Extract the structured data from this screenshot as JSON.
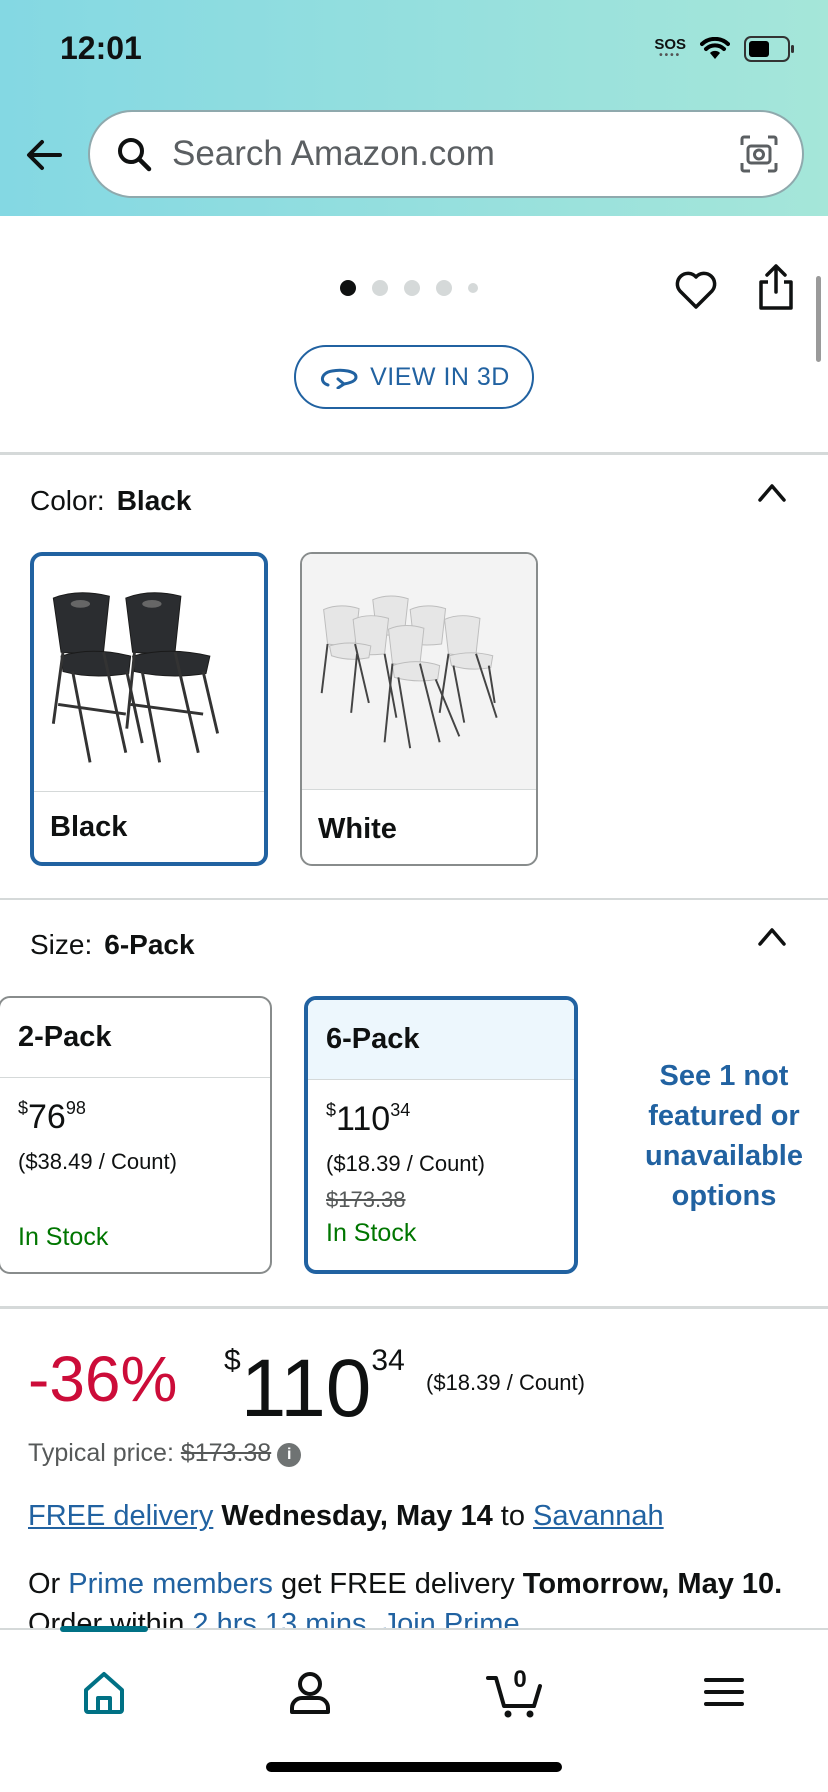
{
  "status_bar": {
    "time": "12:01",
    "sos": "SOS"
  },
  "search": {
    "placeholder": "Search Amazon.com"
  },
  "gallery": {
    "view_3d_label": "VIEW IN 3D"
  },
  "color": {
    "label": "Color:",
    "selected": "Black",
    "options": [
      {
        "name": "Black"
      },
      {
        "name": "White"
      }
    ]
  },
  "size": {
    "label": "Size:",
    "selected": "6-Pack",
    "options": [
      {
        "name": "2-Pack",
        "price_symbol": "$",
        "price_whole": "76",
        "price_fraction": "98",
        "per_unit": "($38.49 / Count)",
        "list_price": "",
        "stock": "In Stock"
      },
      {
        "name": "6-Pack",
        "price_symbol": "$",
        "price_whole": "110",
        "price_fraction": "34",
        "per_unit": "($18.39 / Count)",
        "list_price": "$173.38",
        "stock": "In Stock"
      }
    ],
    "not_featured": "See 1 not featured or unavailable options"
  },
  "price_block": {
    "discount": "-36%",
    "symbol": "$",
    "whole": "110",
    "fraction": "34",
    "per_unit": "($18.39 / Count)",
    "typical_label": "Typical price:",
    "typical_value": "$173.38"
  },
  "delivery": {
    "free_delivery": "FREE delivery",
    "date": "Wednesday, May 14",
    "to": "to",
    "location": "Savannah"
  },
  "prime": {
    "or": "Or",
    "prime_members": "Prime members",
    "get_free": "get FREE delivery",
    "date": "Tomorrow, May 10.",
    "order_within": "Order within",
    "time_left": "2 hrs 13 mins.",
    "join": "Join Prime"
  },
  "bottom_nav": {
    "cart_count": "0"
  },
  "colors": {
    "link": "#2162a1",
    "discount": "#cc0c39",
    "stock": "#007600",
    "selected_border": "#2162a1"
  }
}
